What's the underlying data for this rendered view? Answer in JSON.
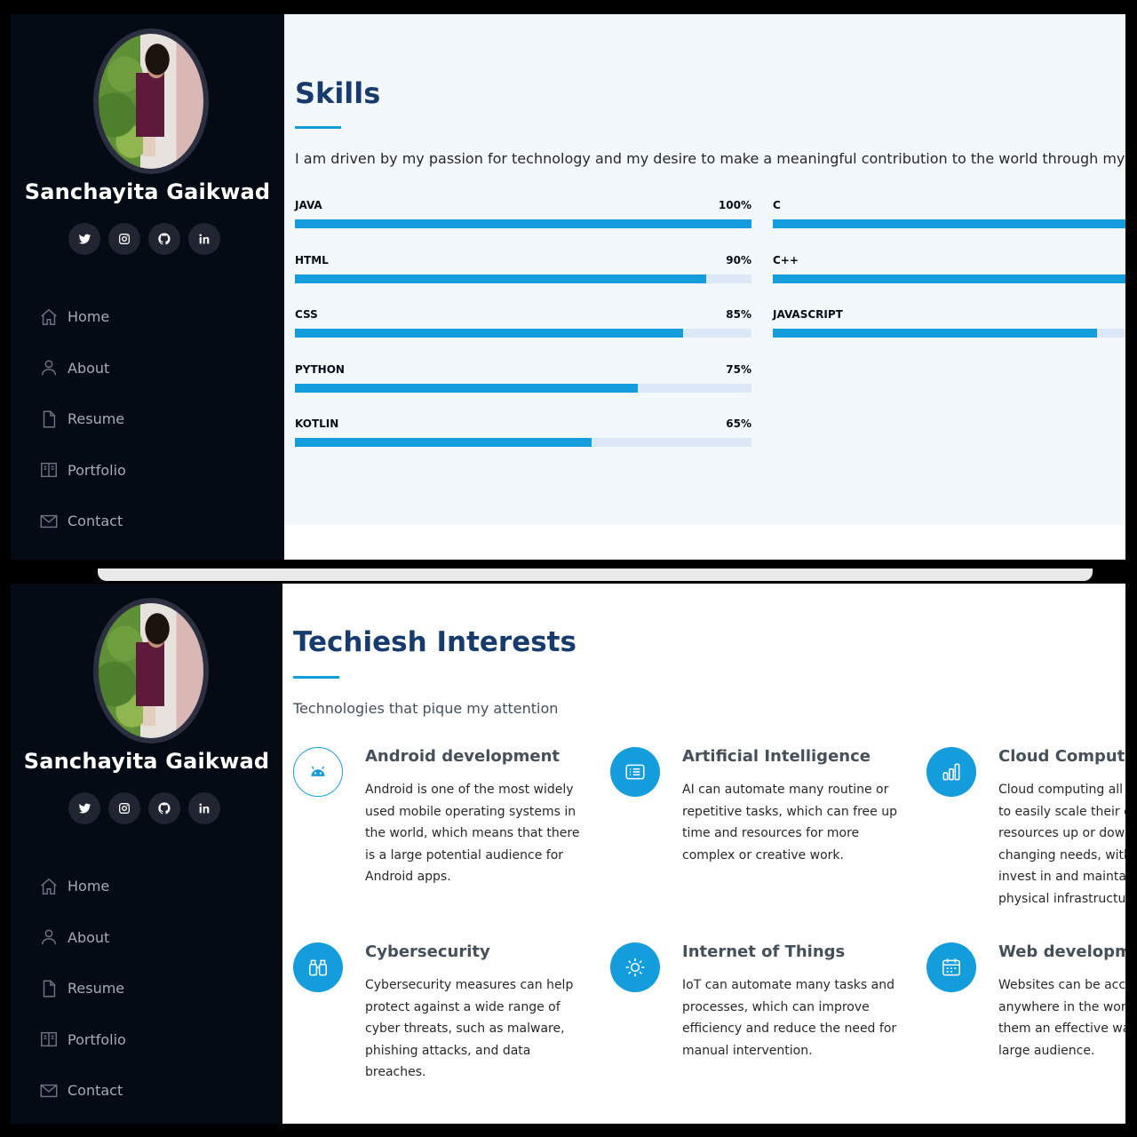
{
  "profile": {
    "name": "Sanchayita Gaikwad",
    "socials": [
      "twitter-icon",
      "instagram-icon",
      "github-icon",
      "linkedin-icon"
    ]
  },
  "nav": [
    {
      "label": "Home",
      "icon": "home-icon"
    },
    {
      "label": "About",
      "icon": "person-icon"
    },
    {
      "label": "Resume",
      "icon": "file-icon"
    },
    {
      "label": "Portfolio",
      "icon": "book-icon"
    },
    {
      "label": "Contact",
      "icon": "envelope-icon"
    }
  ],
  "skills": {
    "title": "Skills",
    "description": "I am driven by my passion for technology and my desire to make a meaningful contribution to the world through my wor",
    "left": [
      {
        "name": "JAVA",
        "percent": "100%",
        "value": 100
      },
      {
        "name": "HTML",
        "percent": "90%",
        "value": 90
      },
      {
        "name": "CSS",
        "percent": "85%",
        "value": 85
      },
      {
        "name": "PYTHON",
        "percent": "75%",
        "value": 75
      },
      {
        "name": "KOTLIN",
        "percent": "65%",
        "value": 65
      }
    ],
    "right": [
      {
        "name": "C",
        "percent": "",
        "value": 100
      },
      {
        "name": "C++",
        "percent": "",
        "value": 100
      },
      {
        "name": "JAVASCRIPT",
        "percent": "",
        "value": 71
      }
    ]
  },
  "interests": {
    "title": "Techiesh Interests",
    "subtitle": "Technologies that pique my attention",
    "items": [
      {
        "title": "Android development",
        "icon": "android-icon",
        "style": "outline",
        "text": "Android is one of the most widely used mobile operating systems in the world, which means that there is a large potential audience for Android apps."
      },
      {
        "title": "Artificial Intelligence",
        "icon": "card-list-icon",
        "style": "filled",
        "text": "AI can automate many routine or repetitive tasks, which can free up time and resources for more complex or creative work."
      },
      {
        "title": "Cloud Computin",
        "icon": "bar-chart-icon",
        "style": "filled",
        "text": "Cloud computing all to easily scale their c resources up or dow changing needs, with invest in and mainta physical infrastructu"
      },
      {
        "title": "Cybersecurity",
        "icon": "binoculars-icon",
        "style": "filled",
        "text": "Cybersecurity measures can help protect against a wide range of cyber threats, such as malware, phishing attacks, and data breaches."
      },
      {
        "title": "Internet of Things",
        "icon": "sun-icon",
        "style": "filled",
        "text": "IoT can automate many tasks and processes, which can improve efficiency and reduce the need for manual intervention."
      },
      {
        "title": "Web developme",
        "icon": "calendar-icon",
        "style": "filled",
        "text": "Websites can be acc anywhere in the wor them an effective wa large audience."
      }
    ]
  },
  "colors": {
    "accent": "#149ddd",
    "sidebar": "#040b14",
    "heading": "#173b6c"
  }
}
